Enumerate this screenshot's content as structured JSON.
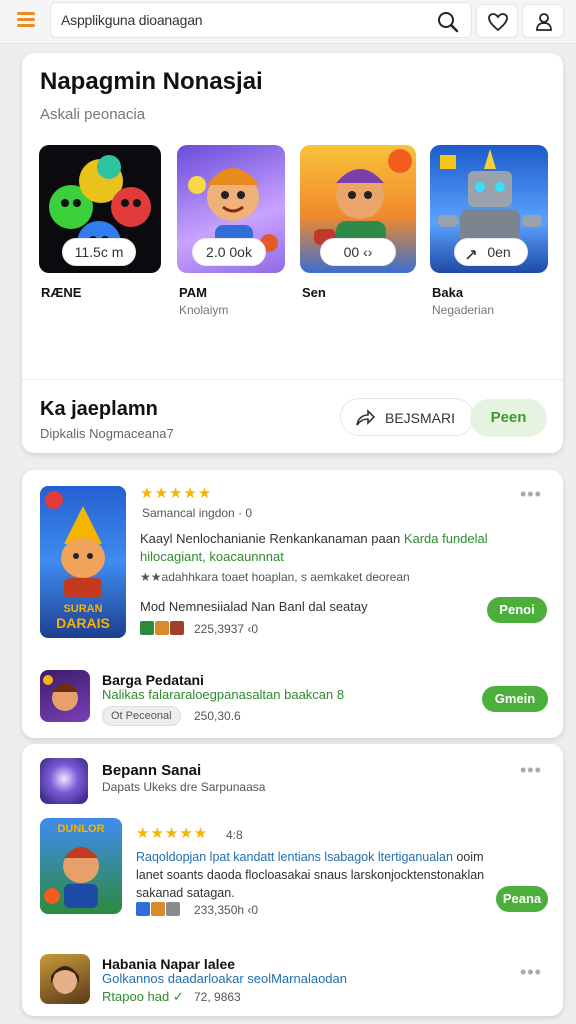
{
  "topbar": {
    "search_text": "Aspplikguna dioanagan",
    "icons": [
      "menu-icon",
      "search-icon",
      "heart-icon",
      "user-icon"
    ],
    "accent": "#ef8a22"
  },
  "featured": {
    "title": "Napagmin Nonasjai",
    "subtitle": "Askali peonacia",
    "apps": [
      {
        "name": "RÆNE",
        "sub": "",
        "pill": "11.5c m"
      },
      {
        "name": "PAM",
        "sub": "Knolaiym",
        "pill": "2.0 0ok"
      },
      {
        "name": "Sen",
        "sub": "",
        "pill": "00 ‹›"
      },
      {
        "name": "Baka",
        "sub": "Negaderian",
        "pill": "0en"
      }
    ],
    "cta_title": "Ka jaeplamn",
    "cta_sub": "Dipkalis Nogmaceana7",
    "share_label": "BEJSMARI",
    "open_label": "Peen"
  },
  "list1": {
    "item1": {
      "stars": "★★★★★",
      "meta": "Samancal ingdon · 0",
      "desc_a": "Kaayl Nenlochanianie Renkankanaman paan",
      "desc_b": "Karda fundelal",
      "desc_c": "hilocagiant, koacaunnnat",
      "review": "★★adahhkara toaet hoaplan, s aemkaket deorean",
      "mod": "Mod Nemnesiialad Nan Banl dal seatay",
      "count": "225,3937 ‹0",
      "button": "Penoi"
    },
    "item2": {
      "title": "Barga Pedatani",
      "desc": "Nalikas falararaloegpanasaltan baakcan 8",
      "tag": "Ot Peceonal",
      "count": "250,30.6",
      "button": "Gmein"
    }
  },
  "list2": {
    "header": {
      "title": "Bepann Sanai",
      "sub": "Dapats Ukeks dre Sarpunaasa"
    },
    "item1": {
      "stars": "★★★★★",
      "rating": "4:8",
      "desc_a": "Raqoldopjan lpat kandatt lentians lsabagok ltertiganualan",
      "desc_b": "ooim",
      "desc_c": "lanet soants daoda flocloasakai snaus larskonjocktenstonaklan",
      "desc_d": "sakanad satagan.",
      "count": "233,350h ‹0",
      "button": "Peana"
    },
    "item2": {
      "title": "Habania Napar lalee",
      "desc": "Golkannos daadarloakar seolMarnalaodan",
      "sub": "Rtapoo had ✓",
      "count": "72, 9863"
    }
  }
}
